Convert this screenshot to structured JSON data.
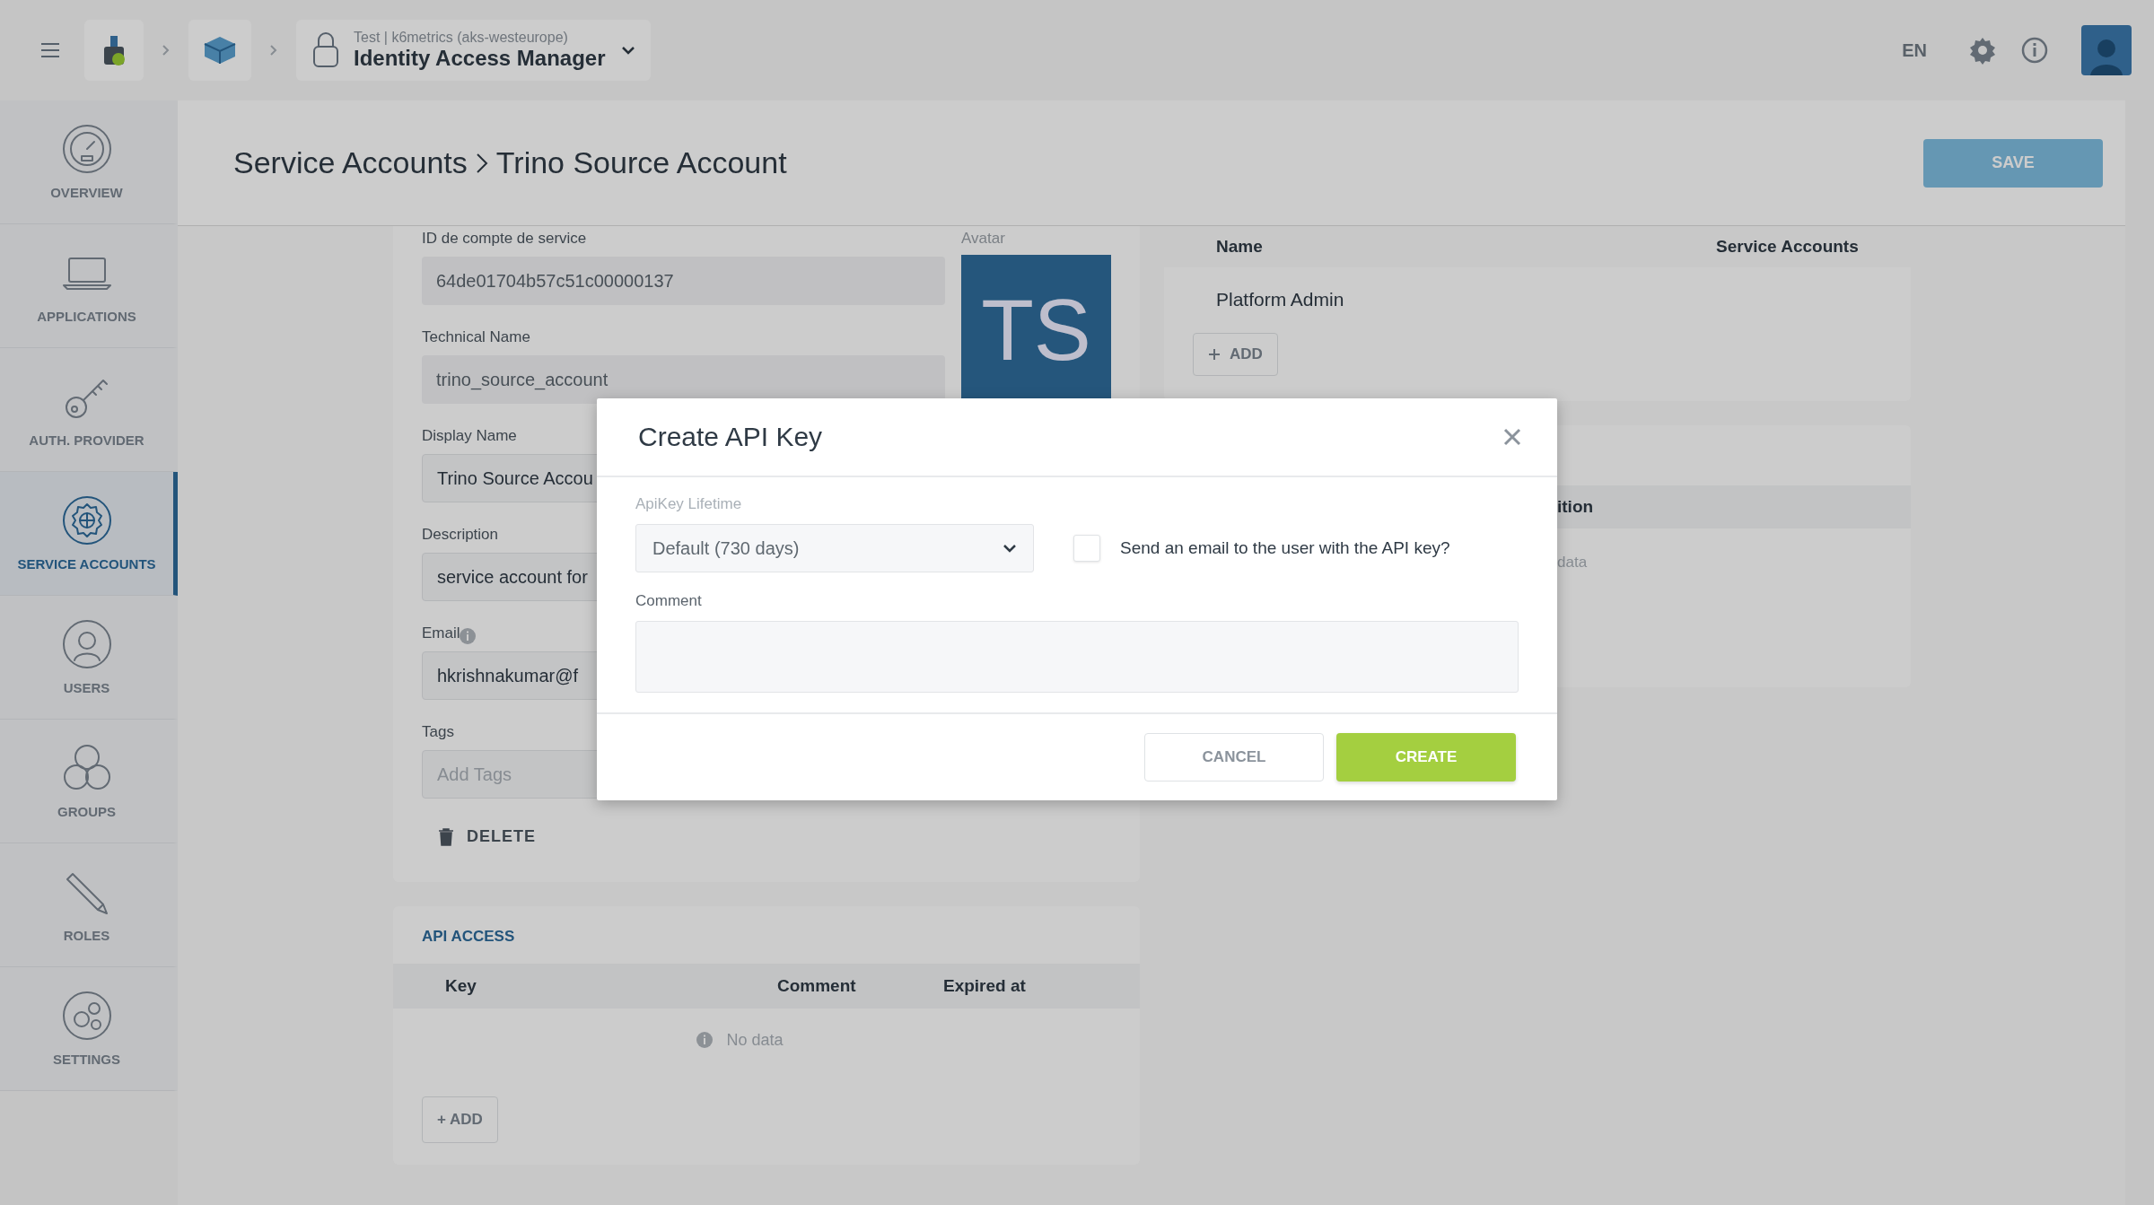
{
  "topbar": {
    "context": "Test | k6metrics (aks-westeurope)",
    "app_name": "Identity Access Manager",
    "language": "EN"
  },
  "sidebar": {
    "items": [
      {
        "label": "OVERVIEW",
        "selected": false
      },
      {
        "label": "APPLICATIONS",
        "selected": false
      },
      {
        "label": "AUTH. PROVIDER",
        "selected": false
      },
      {
        "label": "SERVICE ACCOUNTS",
        "selected": true
      },
      {
        "label": "USERS",
        "selected": false
      },
      {
        "label": "GROUPS",
        "selected": false
      },
      {
        "label": "ROLES",
        "selected": false
      },
      {
        "label": "SETTINGS",
        "selected": false
      }
    ]
  },
  "header": {
    "breadcrumb": [
      "Service Accounts",
      "Trino Source Account"
    ],
    "save_button": {
      "label": "SAVE",
      "disabled": true
    }
  },
  "form": {
    "fields": [
      {
        "label": "ID de compte de service",
        "value": "64de01704b57c51c00000137",
        "readonly": true,
        "info": false
      },
      {
        "label": "Technical Name",
        "value": "trino_source_account",
        "readonly": true,
        "info": false
      },
      {
        "label": "Display Name",
        "value": "Trino Source Accou",
        "readonly": false,
        "info": false
      },
      {
        "label": "Description",
        "value": "service account for",
        "readonly": false,
        "info": false
      },
      {
        "label": "Email",
        "value": "hkrishnakumar@f",
        "readonly": false,
        "info": true
      },
      {
        "label": "Tags",
        "placeholder": "Add Tags",
        "readonly": false,
        "info": false
      }
    ],
    "avatar": {
      "label": "Avatar",
      "initials": "TS"
    },
    "delete_button": "DELETE"
  },
  "api_access": {
    "title": "API ACCESS",
    "columns": [
      "Key",
      "Comment",
      "Expired at"
    ],
    "empty_text": "No data",
    "add_button": "+ ADD"
  },
  "roles": {
    "columns": [
      "Name",
      "Service Accounts"
    ],
    "rows": [
      {
        "name": "Platform Admin"
      }
    ],
    "add_button": "ADD"
  },
  "second_panel": {
    "column_fragment": "ition",
    "empty_fragment": "data"
  },
  "modal": {
    "title": "Create API Key",
    "lifetime": {
      "label": "ApiKey Lifetime",
      "value": "Default (730 days)"
    },
    "send_email": {
      "label": "Send an email to the user with the API key?",
      "checked": false
    },
    "comment": {
      "label": "Comment"
    },
    "buttons": [
      {
        "label": "CANCEL",
        "kind": "secondary"
      },
      {
        "label": "CREATE",
        "kind": "primary"
      }
    ]
  }
}
